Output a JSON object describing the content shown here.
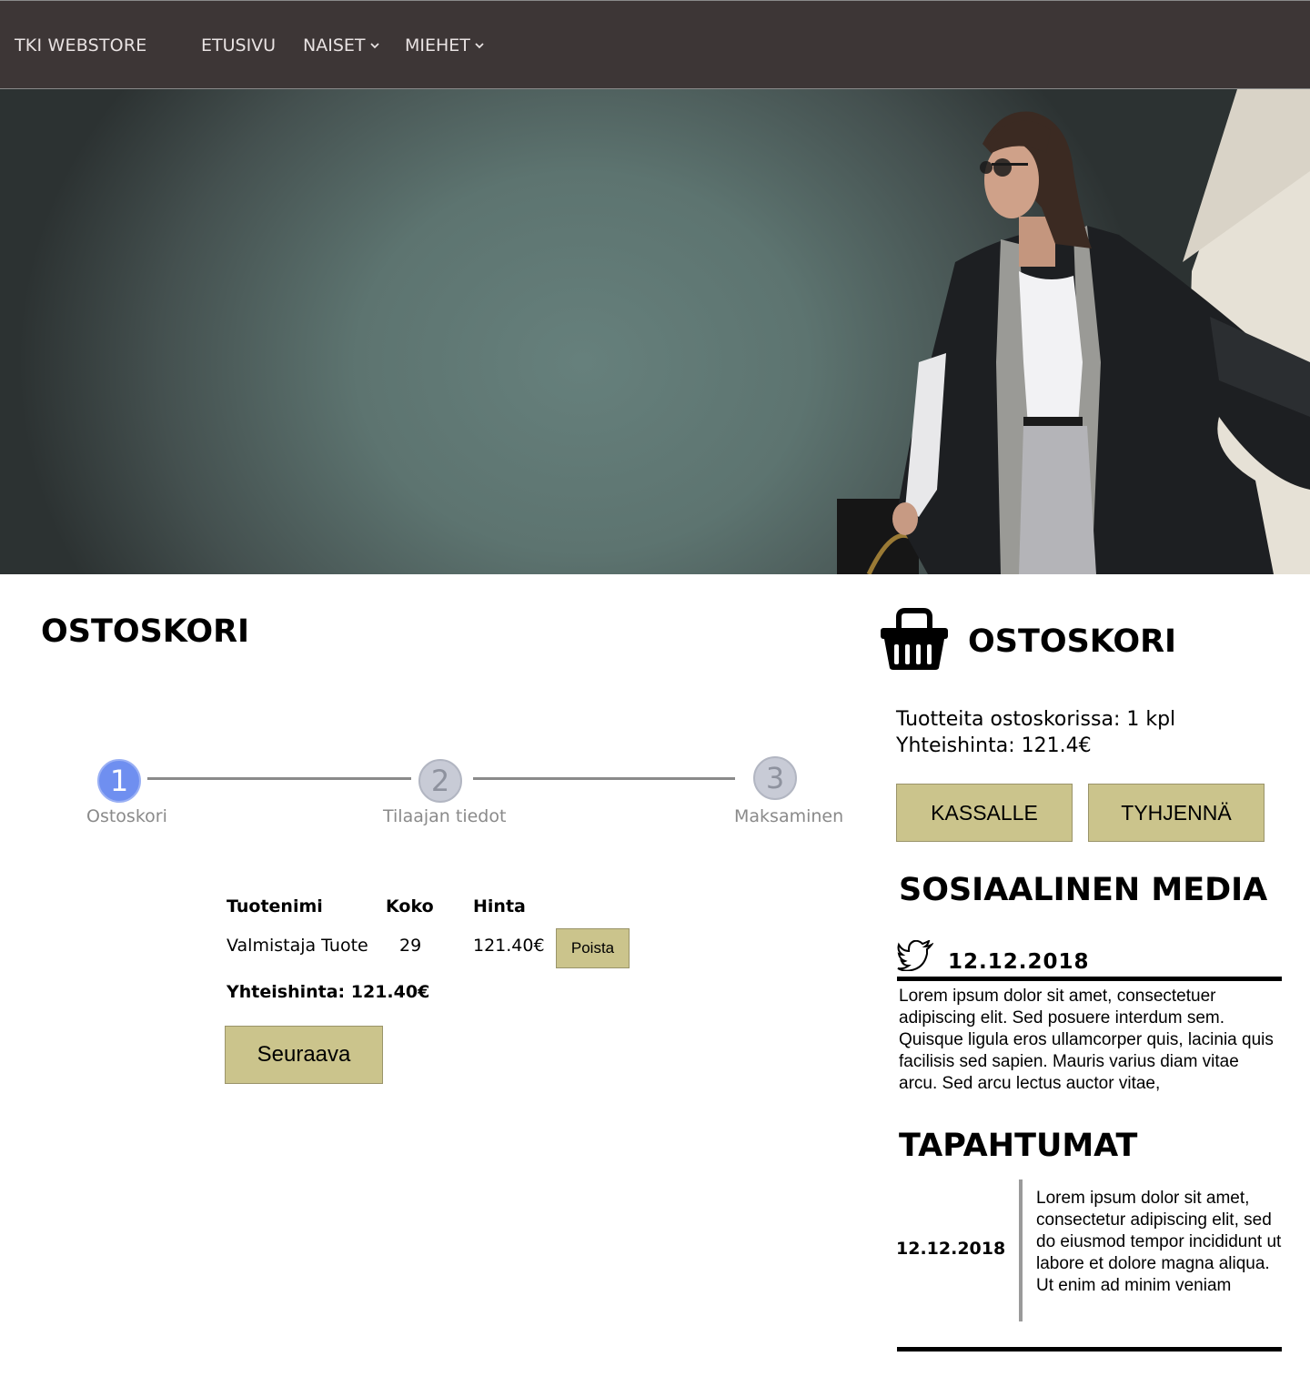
{
  "navbar": {
    "brand": "TKI WEBSTORE",
    "items": [
      {
        "label": "ETUSIVU",
        "dropdown": false
      },
      {
        "label": "NAISET",
        "dropdown": true
      },
      {
        "label": "MIEHET",
        "dropdown": true
      }
    ]
  },
  "main": {
    "title": "OSTOSKORI",
    "stepper": {
      "steps": [
        {
          "number": "1",
          "label": "Ostoskori",
          "state": "active"
        },
        {
          "number": "2",
          "label": "Tilaajan tiedot",
          "state": "inactive"
        },
        {
          "number": "3",
          "label": "Maksaminen",
          "state": "inactive"
        }
      ]
    },
    "cart": {
      "headers": [
        "Tuotenimi",
        "Koko",
        "Hinta"
      ],
      "rows": [
        {
          "name": "Valmistaja Tuote",
          "size": "29",
          "price": "121.40€",
          "remove_label": "Poista"
        }
      ],
      "total": "Yhteishinta: 121.40€",
      "next_label": "Seuraava"
    }
  },
  "sidebar": {
    "title": "OSTOSKORI",
    "items_count": "Tuotteita ostoskorissa: 1 kpl",
    "total_price": "Yhteishinta: 121.4€",
    "checkout_label": "KASSALLE",
    "clear_label": "TYHJENNÄ",
    "social": {
      "title": "SOSIAALINEN MEDIA",
      "icon": "twitter-icon",
      "date": "12.12.2018",
      "text": "Lorem ipsum dolor sit amet, consectetuer adipiscing elit. Sed posuere interdum sem. Quisque ligula eros ullamcorper quis, lacinia quis facilisis sed sapien. Mauris varius diam vitae arcu. Sed arcu lectus auctor vitae,"
    },
    "events": {
      "title": "TAPAHTUMAT",
      "date": "12.12.2018",
      "text": "Lorem ipsum dolor sit amet, consectetur adipiscing elit, sed do eiusmod tempor incididunt ut labore et dolore magna aliqua. Ut enim ad minim veniam"
    }
  },
  "colors": {
    "navbar_bg": "#3d3636",
    "button_bg": "#cbc48c",
    "step_active": "#6f8ff0",
    "step_inactive": "#c8cbd6"
  }
}
